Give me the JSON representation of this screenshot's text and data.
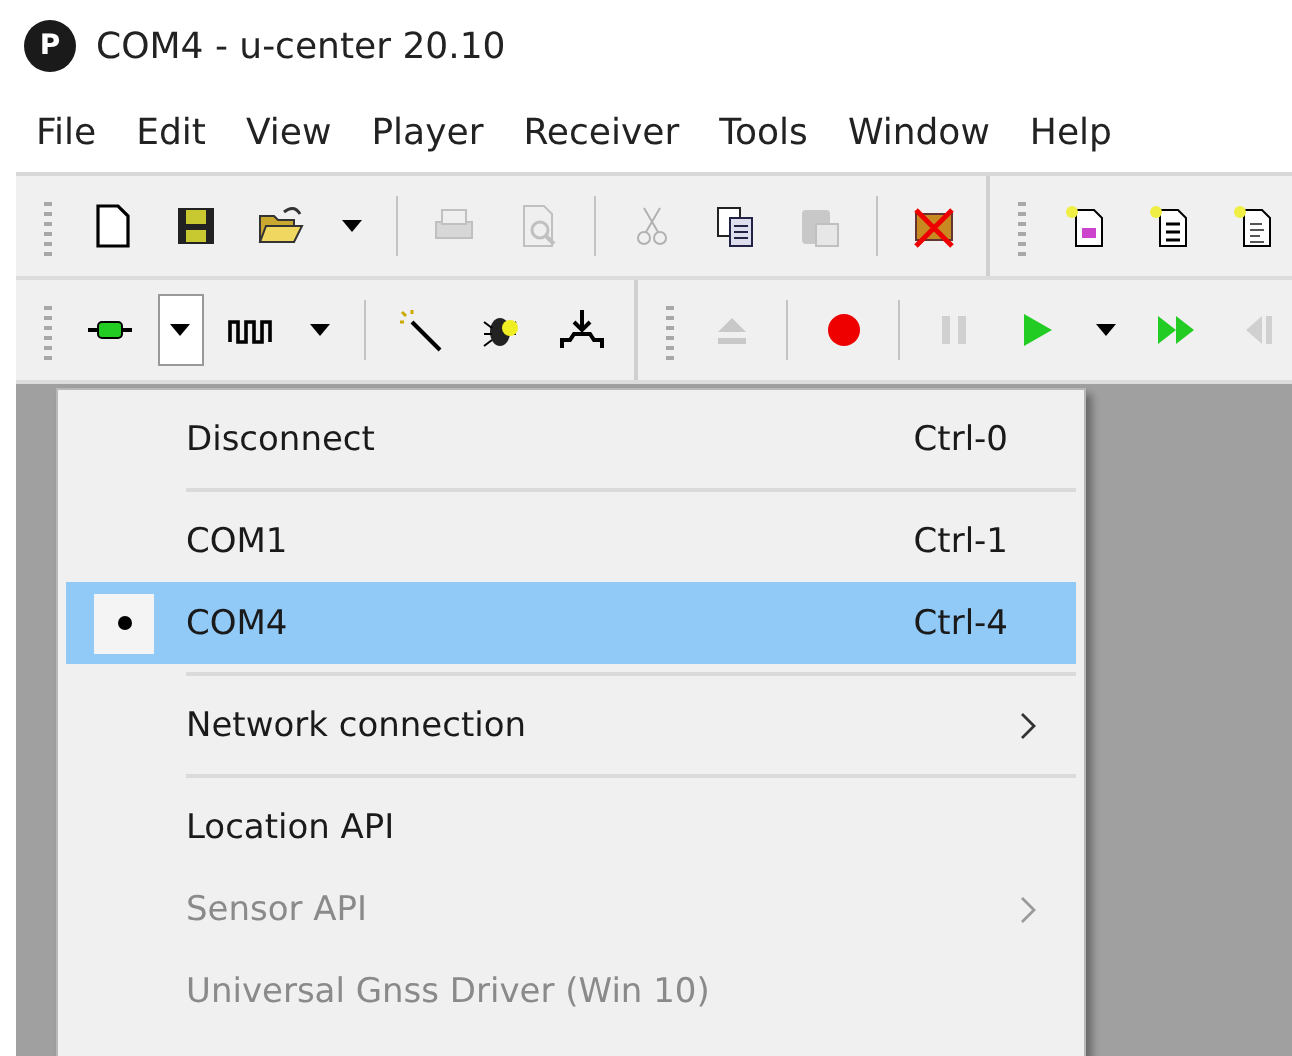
{
  "window": {
    "title": "COM4 - u-center 20.10",
    "app_initial": "P"
  },
  "menu_bar": [
    "File",
    "Edit",
    "View",
    "Player",
    "Receiver",
    "Tools",
    "Window",
    "Help"
  ],
  "toolbars": [
    {
      "items": [
        {
          "kind": "grip"
        },
        {
          "kind": "button",
          "disabled": false
        },
        {
          "kind": "button",
          "disabled": false
        },
        {
          "kind": "button",
          "disabled": false
        },
        {
          "kind": "caret",
          "disabled": false,
          "pressed": false
        },
        {
          "kind": "separator"
        },
        {
          "kind": "button",
          "disabled": true
        },
        {
          "kind": "button",
          "disabled": true
        },
        {
          "kind": "separator"
        },
        {
          "kind": "button",
          "disabled": true
        },
        {
          "kind": "button",
          "disabled": false
        },
        {
          "kind": "button",
          "disabled": true
        },
        {
          "kind": "separator"
        },
        {
          "kind": "button",
          "disabled": false
        },
        {
          "kind": "divider"
        },
        {
          "kind": "grip"
        },
        {
          "kind": "button",
          "disabled": false
        },
        {
          "kind": "button",
          "disabled": false
        },
        {
          "kind": "button",
          "disabled": false
        }
      ]
    },
    {
      "items": [
        {
          "kind": "grip"
        },
        {
          "kind": "button",
          "disabled": false
        },
        {
          "kind": "caret",
          "disabled": false,
          "pressed": true
        },
        {
          "kind": "button",
          "disabled": false
        },
        {
          "kind": "caret",
          "disabled": false,
          "pressed": false
        },
        {
          "kind": "separator"
        },
        {
          "kind": "button",
          "disabled": false
        },
        {
          "kind": "button",
          "disabled": false
        },
        {
          "kind": "button",
          "disabled": false
        },
        {
          "kind": "divider"
        },
        {
          "kind": "grip"
        },
        {
          "kind": "button",
          "disabled": true
        },
        {
          "kind": "separator"
        },
        {
          "kind": "button",
          "disabled": false
        },
        {
          "kind": "separator"
        },
        {
          "kind": "button",
          "disabled": true
        },
        {
          "kind": "button",
          "disabled": false
        },
        {
          "kind": "caret",
          "disabled": false,
          "pressed": false
        },
        {
          "kind": "button",
          "disabled": false
        },
        {
          "kind": "button",
          "disabled": true
        }
      ]
    }
  ],
  "dropdown_menu": {
    "items": [
      {
        "kind": "item",
        "label": "Disconnect",
        "shortcut": "Ctrl-0",
        "selected": false,
        "checked": false,
        "disabled": false,
        "submenu": false
      },
      {
        "kind": "separator"
      },
      {
        "kind": "item",
        "label": "COM1",
        "shortcut": "Ctrl-1",
        "selected": false,
        "checked": false,
        "disabled": false,
        "submenu": false
      },
      {
        "kind": "item",
        "label": "COM4",
        "shortcut": "Ctrl-4",
        "selected": true,
        "checked": true,
        "disabled": false,
        "submenu": false
      },
      {
        "kind": "separator"
      },
      {
        "kind": "item",
        "label": "Network connection",
        "selected": false,
        "checked": false,
        "disabled": false,
        "submenu": true
      },
      {
        "kind": "separator"
      },
      {
        "kind": "item",
        "label": "Location API",
        "selected": false,
        "checked": false,
        "disabled": false,
        "submenu": false
      },
      {
        "kind": "item",
        "label": "Sensor API",
        "selected": false,
        "checked": false,
        "disabled": true,
        "submenu": true
      },
      {
        "kind": "item",
        "label": "Universal Gnss Driver (Win 10)",
        "selected": false,
        "checked": false,
        "disabled": true,
        "submenu": false
      }
    ]
  }
}
